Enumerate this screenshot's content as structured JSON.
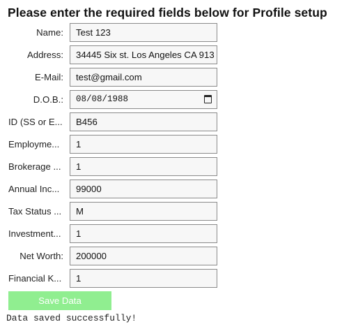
{
  "page": {
    "title": "Please enter the required fields below for Profile setup"
  },
  "form": {
    "name": {
      "label": "Name:",
      "value": "Test 123"
    },
    "address": {
      "label": "Address:",
      "value": "34445 Six st. Los Angeles CA 913"
    },
    "email": {
      "label": "E-Mail:",
      "value": "test@gmail.com"
    },
    "dob": {
      "label": "D.O.B.:",
      "value": "08/08/1988"
    },
    "id": {
      "label": "ID (SS or E...",
      "value": "B456"
    },
    "employment": {
      "label": "Employme...",
      "value": "1"
    },
    "brokerage": {
      "label": "Brokerage ...",
      "value": "1"
    },
    "annual_income": {
      "label": "Annual Inc...",
      "value": "99000"
    },
    "tax_status": {
      "label": "Tax Status ...",
      "value": "M"
    },
    "investment": {
      "label": "Investment...",
      "value": "1"
    },
    "net_worth": {
      "label": "Net Worth:",
      "value": "200000"
    },
    "financial_knowledge": {
      "label": "Financial K...",
      "value": "1"
    }
  },
  "actions": {
    "save_label": "Save Data"
  },
  "status": {
    "message": "Data saved successfully!"
  },
  "colors": {
    "save_button_bg": "#90ee90",
    "save_button_text": "#ffffff",
    "field_border": "#8a8a8a",
    "field_bg": "#f7f7f7"
  },
  "icons": {
    "date_picker": "calendar-icon"
  }
}
